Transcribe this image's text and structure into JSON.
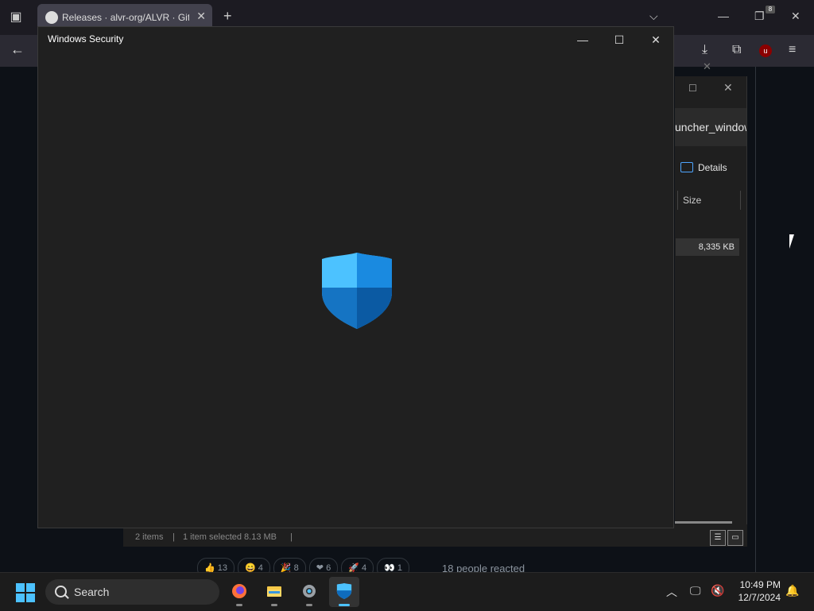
{
  "browser": {
    "tab_title": "Releases · alvr-org/ALVR · GitHub",
    "extension_badge": "8"
  },
  "page": {
    "reactions": [
      {
        "icon": "thumbs-up",
        "count": "13"
      },
      {
        "icon": "laugh",
        "count": "4"
      },
      {
        "icon": "tada",
        "count": "8"
      },
      {
        "icon": "heart",
        "count": "6"
      },
      {
        "icon": "rocket",
        "count": "4"
      },
      {
        "icon": "eyes",
        "count": "1"
      }
    ],
    "reacted_text": "18 people reacted"
  },
  "explorer": {
    "path_fragment": "uncher_window",
    "details_label": "Details",
    "size_header": "Size",
    "row_size": "8,335 KB",
    "status_items": "2 items",
    "status_selected": "1 item selected  8.13 MB"
  },
  "security_window": {
    "title": "Windows Security"
  },
  "taskbar": {
    "search_label": "Search",
    "time": "10:49 PM",
    "date": "12/7/2024",
    "apps": [
      "firefox",
      "file-explorer",
      "settings",
      "windows-security"
    ]
  },
  "colors": {
    "accent": "#4cc2ff",
    "shield_light": "#4cc2ff",
    "shield_dark": "#0f6cbd",
    "window_bg": "#202020"
  }
}
